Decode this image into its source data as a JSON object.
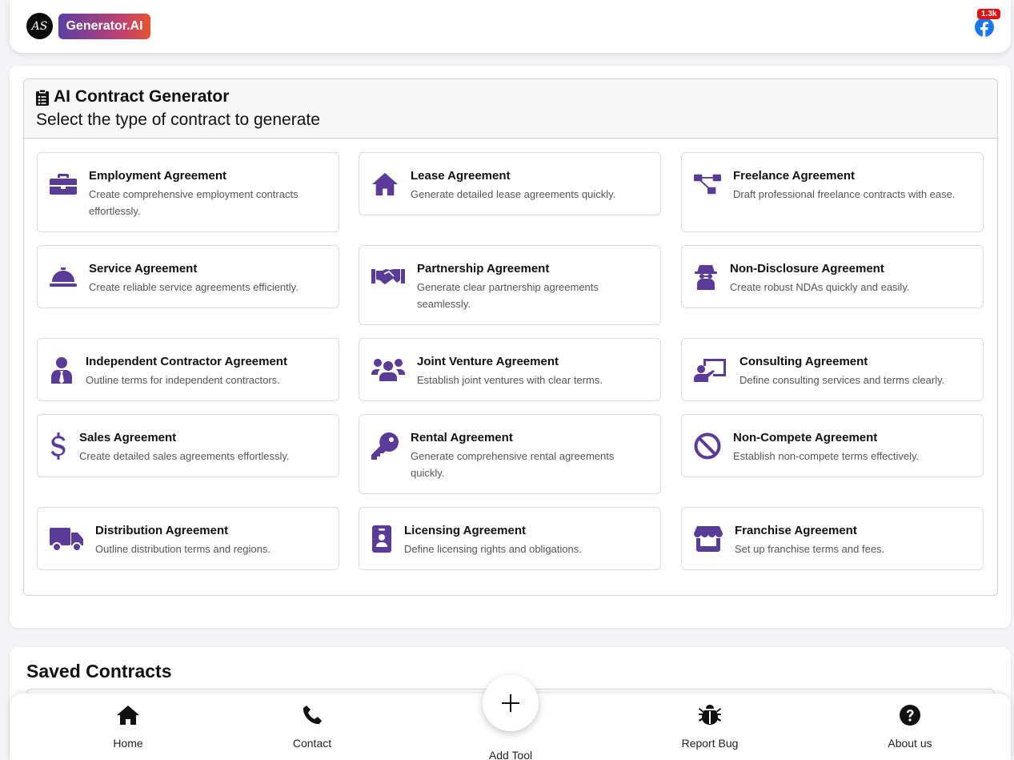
{
  "header": {
    "avatar_text": "AS",
    "brand_label": "Generator.AI",
    "facebook_badge": "1.3k",
    "facebook_icon": "facebook-icon"
  },
  "generator": {
    "title": "AI Contract Generator",
    "subtitle": "Select the type of contract to generate",
    "title_icon": "clipboard-list-icon",
    "accent_color": "#5a3b98",
    "contracts": [
      {
        "title": "Employment Agreement",
        "description": "Create comprehensive employment contracts effortlessly.",
        "icon": "briefcase-icon"
      },
      {
        "title": "Lease Agreement",
        "description": "Generate detailed lease agreements quickly.",
        "icon": "house-icon"
      },
      {
        "title": "Freelance Agreement",
        "description": "Draft professional freelance contracts with ease.",
        "icon": "sitemap-icon"
      },
      {
        "title": "Service Agreement",
        "description": "Create reliable service agreements efficiently.",
        "icon": "concierge-bell-icon"
      },
      {
        "title": "Partnership Agreement",
        "description": "Generate clear partnership agreements seamlessly.",
        "icon": "handshake-icon"
      },
      {
        "title": "Non-Disclosure Agreement",
        "description": "Create robust NDAs quickly and easily.",
        "icon": "user-secret-icon"
      },
      {
        "title": "Independent Contractor Agreement",
        "description": "Outline terms for independent contractors.",
        "icon": "user-tie-icon"
      },
      {
        "title": "Joint Venture Agreement",
        "description": "Establish joint ventures with clear terms.",
        "icon": "users-icon"
      },
      {
        "title": "Consulting Agreement",
        "description": "Define consulting services and terms clearly.",
        "icon": "chalkboard-teacher-icon"
      },
      {
        "title": "Sales Agreement",
        "description": "Create detailed sales agreements effortlessly.",
        "icon": "dollar-sign-icon"
      },
      {
        "title": "Rental Agreement",
        "description": "Generate comprehensive rental agreements quickly.",
        "icon": "key-icon"
      },
      {
        "title": "Non-Compete Agreement",
        "description": "Establish non-compete terms effectively.",
        "icon": "ban-icon"
      },
      {
        "title": "Distribution Agreement",
        "description": "Outline distribution terms and regions.",
        "icon": "truck-icon"
      },
      {
        "title": "Licensing Agreement",
        "description": "Define licensing rights and obligations.",
        "icon": "id-badge-icon"
      },
      {
        "title": "Franchise Agreement",
        "description": "Set up franchise terms and fees.",
        "icon": "store-icon"
      }
    ]
  },
  "saved": {
    "title": "Saved Contracts"
  },
  "bottom_nav": {
    "home": "Home",
    "contact": "Contact",
    "add_tool": "Add Tool",
    "report_bug": "Report Bug",
    "about": "About us"
  }
}
